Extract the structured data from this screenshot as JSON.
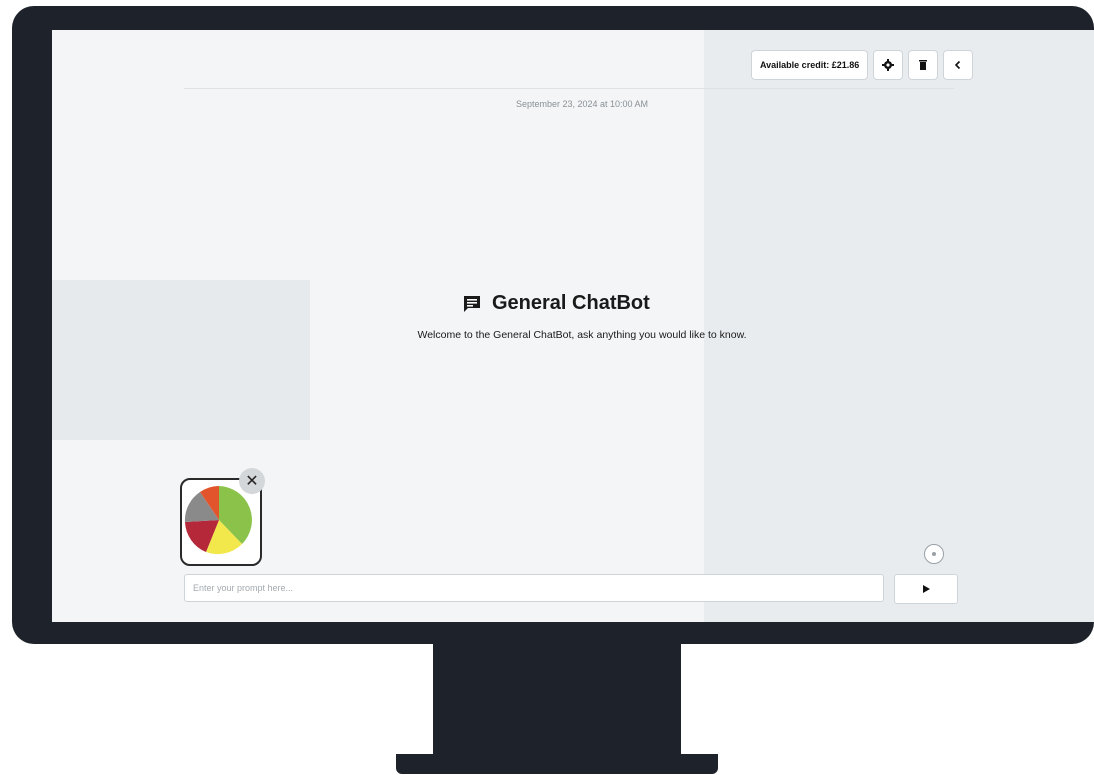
{
  "toolbar": {
    "credit_label": "Available credit: £21.86",
    "settings_icon": "gear-icon",
    "delete_icon": "trash-icon",
    "collapse_icon": "chevron-left-icon"
  },
  "chat": {
    "timestamp": "September 23, 2024 at 10:00 AM",
    "bot_icon": "chat-icon",
    "title": "General ChatBot",
    "welcome": "Welcome to the General ChatBot, ask anything you would like to know."
  },
  "attachment": {
    "close_glyph": "✕",
    "thumbnail": "pie-chart-image"
  },
  "input": {
    "placeholder": "Enter your prompt here...",
    "value": ""
  },
  "send": {
    "icon": "play-icon"
  },
  "colors": {
    "bezel": "#1d222b",
    "screen": "#f3f5f6",
    "pie_green": "#8bc34a",
    "pie_yellow": "#f2e84b",
    "pie_red": "#b5283a",
    "pie_gray": "#8a8a8a",
    "pie_orange": "#e2542c"
  }
}
